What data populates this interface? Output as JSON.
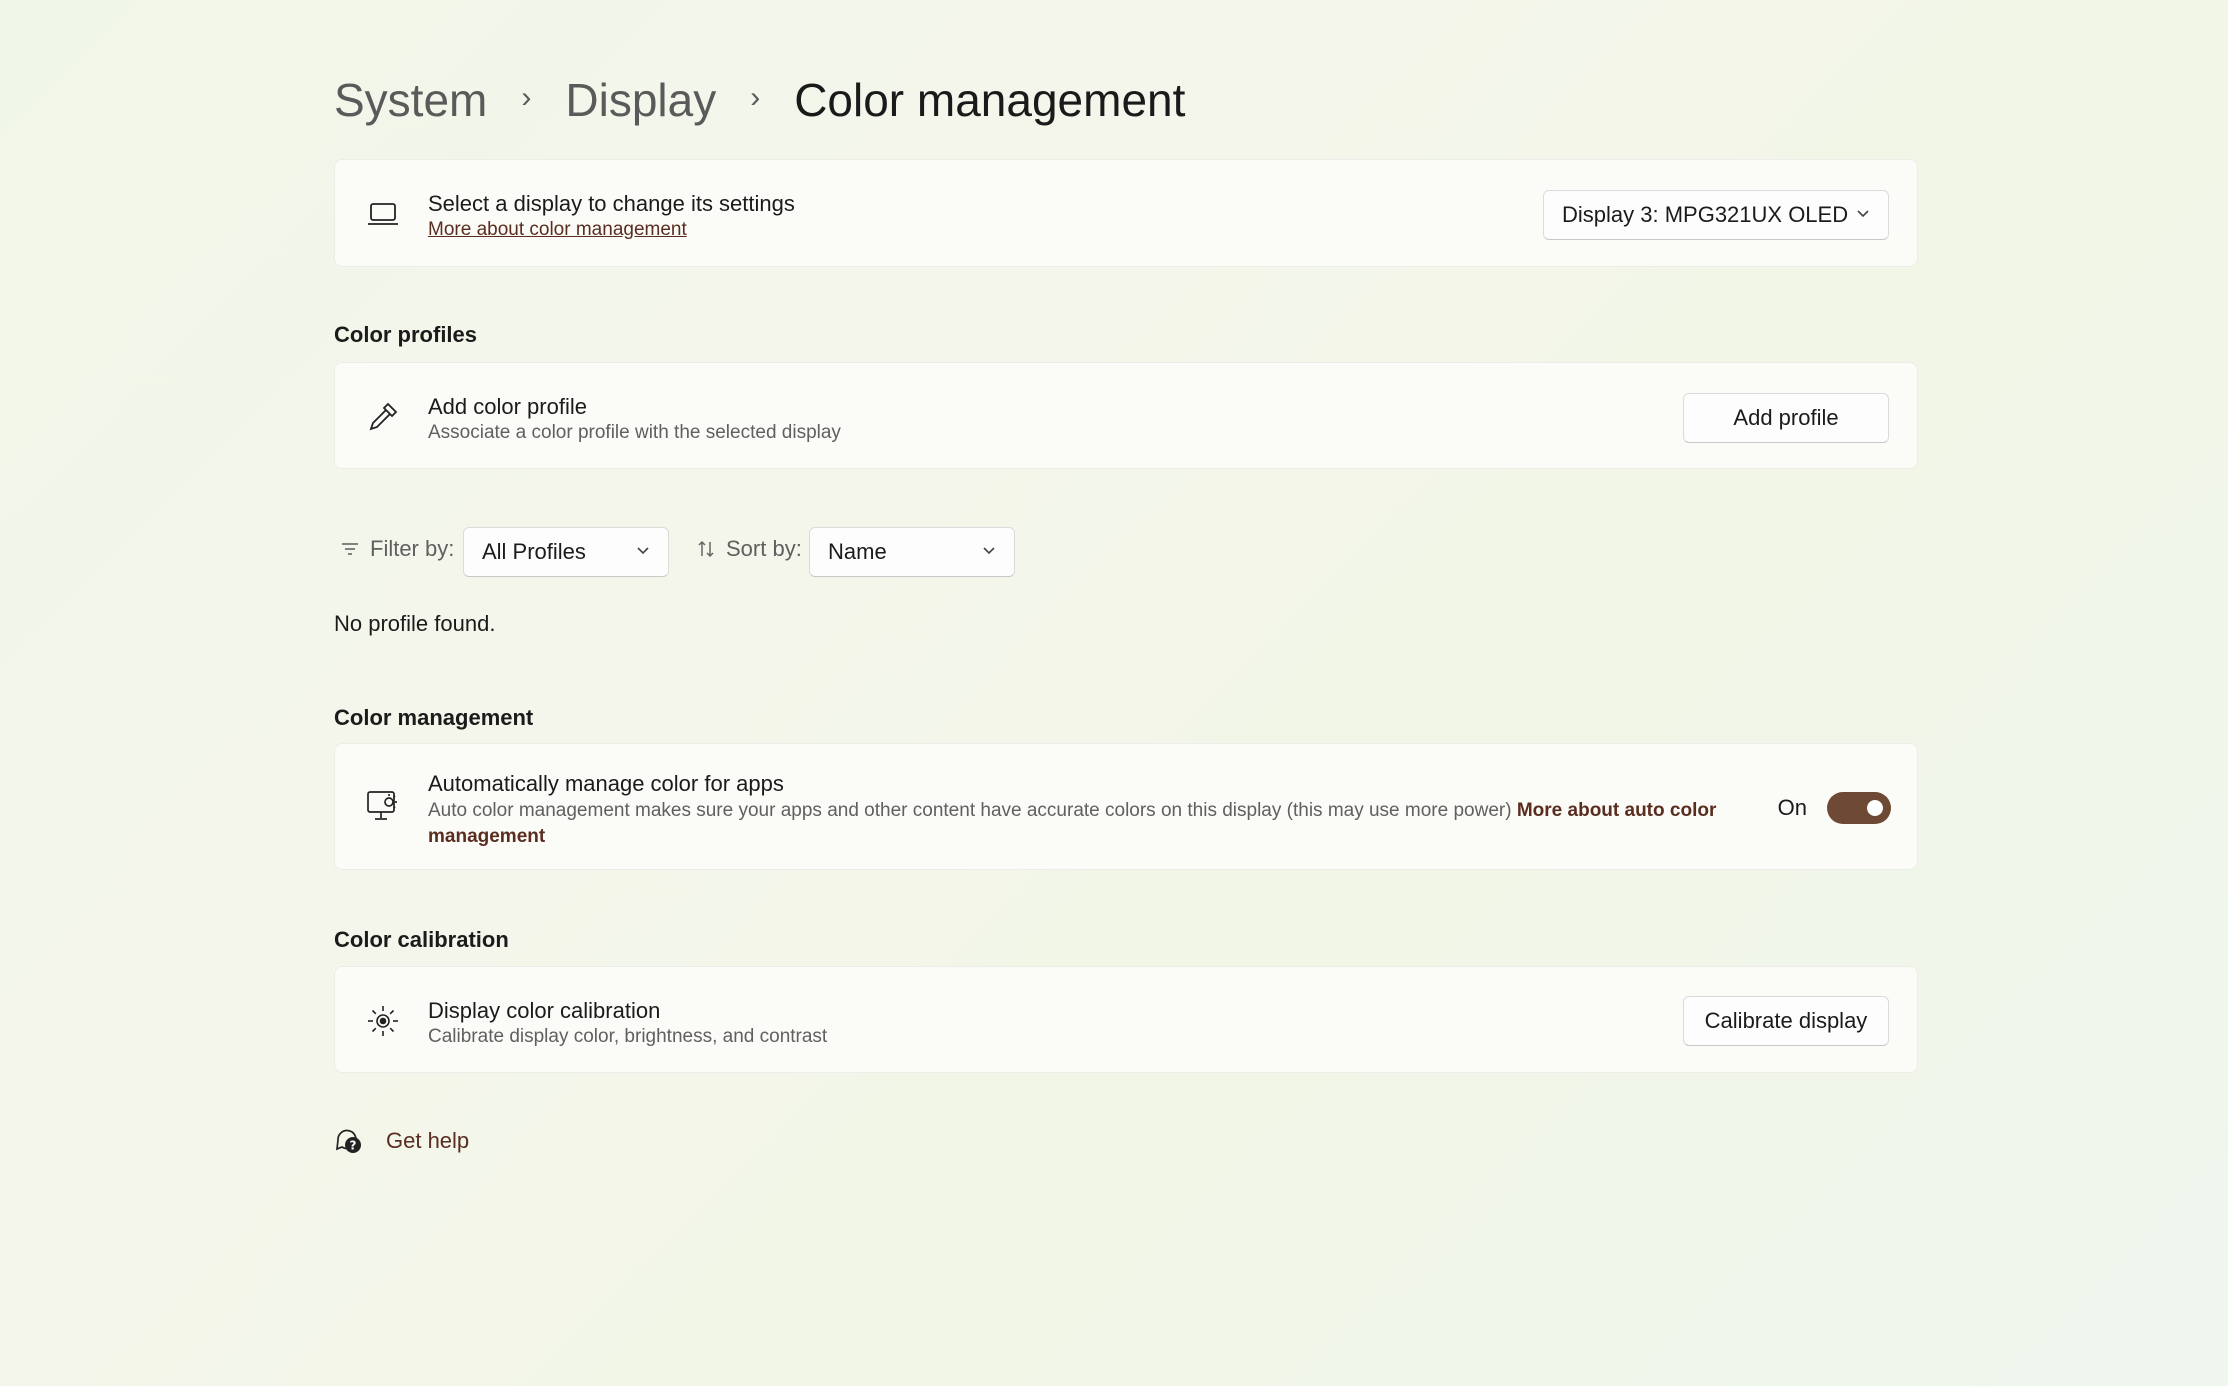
{
  "breadcrumb": {
    "items": [
      "System",
      "Display"
    ],
    "current": "Color management"
  },
  "display_selector": {
    "title": "Select a display to change its settings",
    "link": "More about color management",
    "selected": "Display 3: MPG321UX OLED",
    "icon": "laptop-icon"
  },
  "color_profiles": {
    "heading": "Color profiles",
    "add": {
      "title": "Add color profile",
      "subtitle": "Associate a color profile with the selected display",
      "button": "Add profile",
      "icon": "eyedropper-icon"
    },
    "filter": {
      "label": "Filter by:",
      "value": "All Profiles"
    },
    "sort": {
      "label": "Sort by:",
      "value": "Name"
    },
    "empty_message": "No profile found."
  },
  "color_management": {
    "heading": "Color management",
    "auto": {
      "title": "Automatically manage color for apps",
      "subtitle": "Auto color management makes sure your apps and other content have accurate colors on this display (this may use more power)",
      "link": "More about auto color management",
      "state_label": "On",
      "enabled": true,
      "icon": "monitor-color-icon"
    }
  },
  "color_calibration": {
    "heading": "Color calibration",
    "item": {
      "title": "Display color calibration",
      "subtitle": "Calibrate display color, brightness, and contrast",
      "button": "Calibrate display",
      "icon": "brightness-icon"
    }
  },
  "help": {
    "label": "Get help",
    "icon": "help-chat-icon"
  },
  "colors": {
    "accent": "#6e4a36",
    "link": "#5a2d20"
  }
}
